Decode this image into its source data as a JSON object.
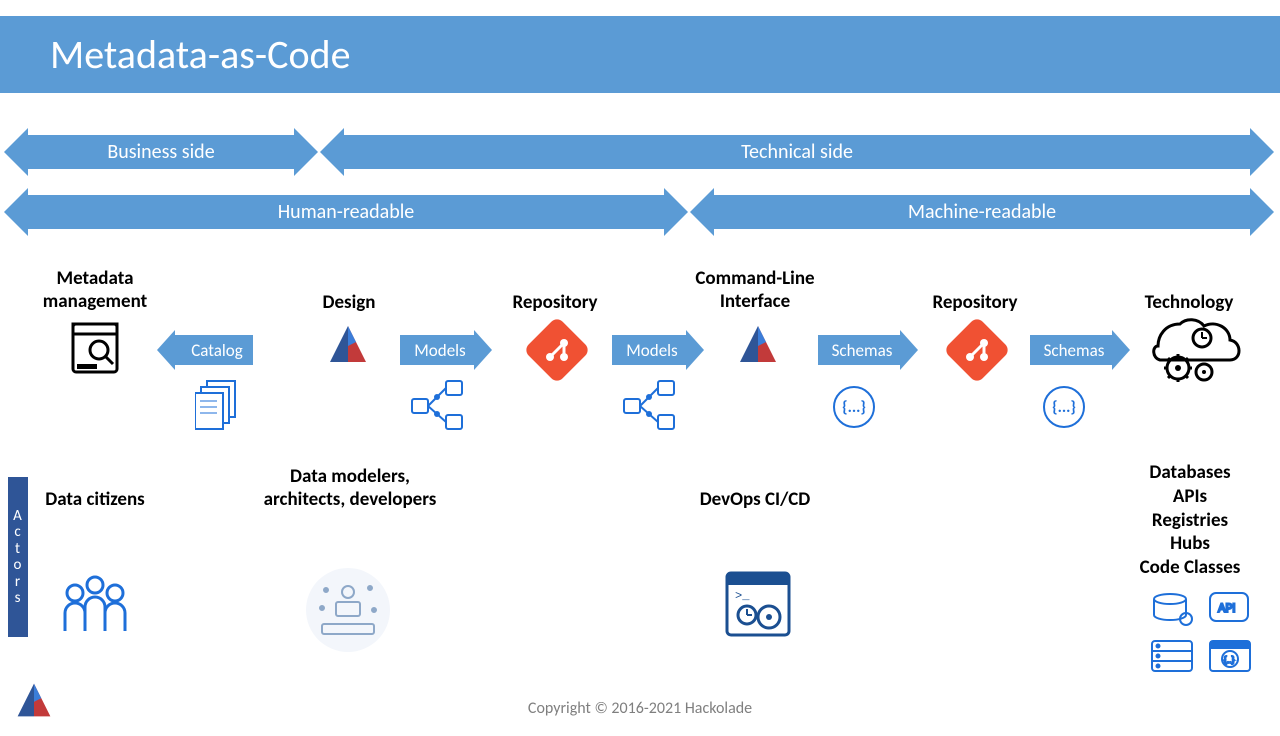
{
  "title": "Metadata-as-Code",
  "sections": {
    "business": "Business side",
    "technical": "Technical side",
    "human": "Human-readable",
    "machine": "Machine-readable"
  },
  "columns": {
    "c1": "Metadata management",
    "c2": "Design",
    "c3": "Repository",
    "c4": "Command-Line Interface",
    "c5": "Repository",
    "c6": "Technology"
  },
  "arrows": {
    "catalog": "Catalog",
    "models1": "Models",
    "models2": "Models",
    "schemas1": "Schemas",
    "schemas2": "Schemas"
  },
  "actors": {
    "a1": "Data citizens",
    "a2": "Data modelers, architects, developers",
    "a4": "DevOps CI/CD"
  },
  "actors_tag": "Actors",
  "tech_list": [
    "Databases",
    "APIs",
    "Registries",
    "Hubs",
    "Code Classes"
  ],
  "footer": "Copyright © 2016-2021 Hackolade"
}
